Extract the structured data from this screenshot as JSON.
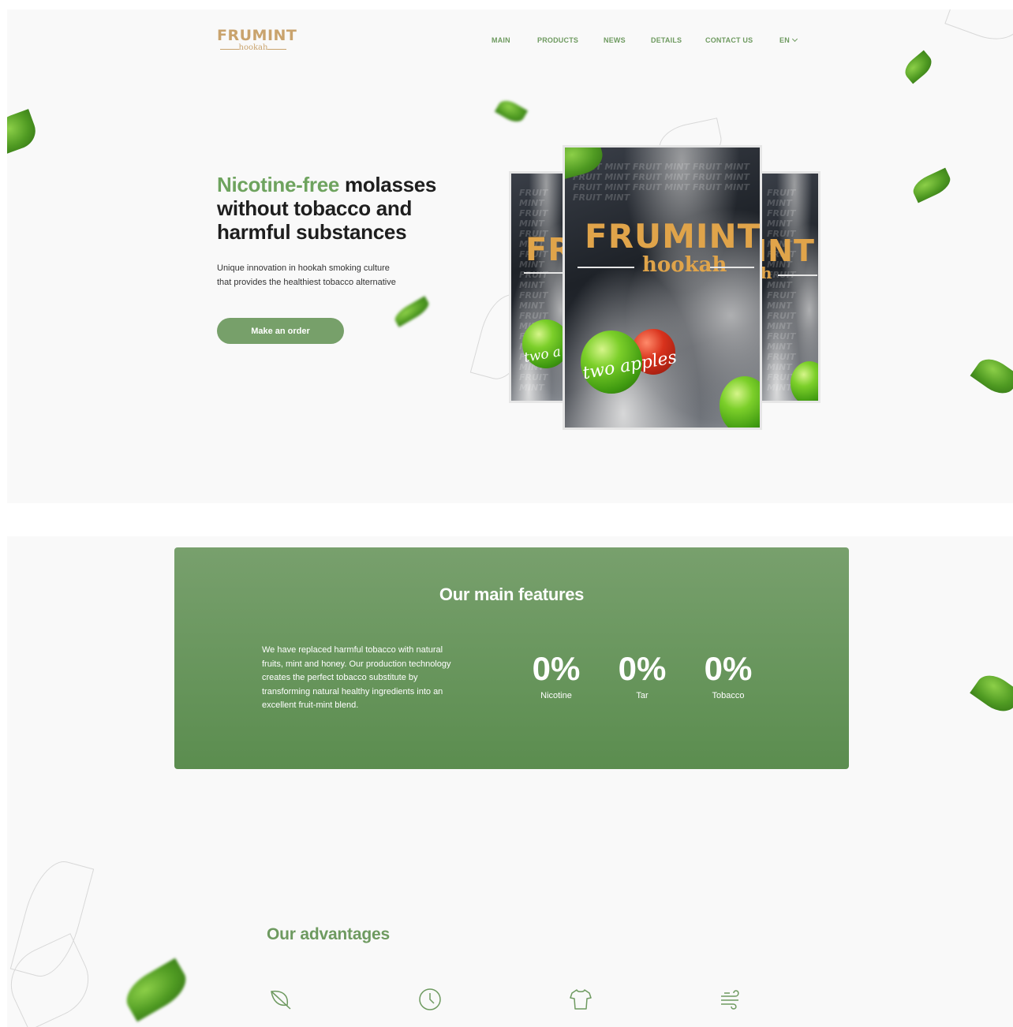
{
  "header": {
    "logo_text": "FRUMINT",
    "logo_subtext": "hookah",
    "nav": [
      {
        "label": "MAIN"
      },
      {
        "label": "PRODUCTS"
      },
      {
        "label": "NEWS"
      },
      {
        "label": "DETAILS"
      },
      {
        "label": "CONTACT US"
      }
    ],
    "language": "EN"
  },
  "hero": {
    "headline_accent": "Nicotine-free",
    "headline_rest_1": " molasses",
    "headline_line_2": "without tobacco and",
    "headline_line_3": "harmful substances",
    "subtitle_line_1": "Unique innovation in hookah smoking culture",
    "subtitle_line_2": "that provides the healthiest tobacco alternative",
    "cta_label": "Make an order",
    "pack": {
      "brand": "FRUMINT",
      "sub": "hookah",
      "flavor": "two apples",
      "pattern_text": "FRUIT MINT FRUIT MINT FRUIT MINT FRUIT MINT FRUIT MINT FRUIT MINT FRUIT MINT FRUIT MINT FRUIT MINT FRUIT MINT",
      "side_brand_left": "FR",
      "side_brand_right": "INT",
      "side_sub_right": "h",
      "side_flavor_left": "two a"
    }
  },
  "features": {
    "title": "Our main features",
    "description": "We have replaced harmful tobacco with natural fruits, mint and honey. Our production technology creates the perfect tobacco substitute by transforming natural healthy ingredients into an excellent fruit-mint blend.",
    "stats": [
      {
        "value": "0%",
        "label": "Nicotine"
      },
      {
        "value": "0%",
        "label": "Tar"
      },
      {
        "value": "0%",
        "label": "Tobacco"
      }
    ]
  },
  "advantages": {
    "title": "Our advantages",
    "icons": [
      "leaf-icon",
      "clock-icon",
      "tshirt-icon",
      "wind-icon"
    ]
  },
  "colors": {
    "brand_gold": "#c9a36d",
    "accent_green": "#6e9a60",
    "cta_green": "#77a06a",
    "panel_green_top": "#78a06d",
    "panel_green_bottom": "#5b8d4f"
  }
}
